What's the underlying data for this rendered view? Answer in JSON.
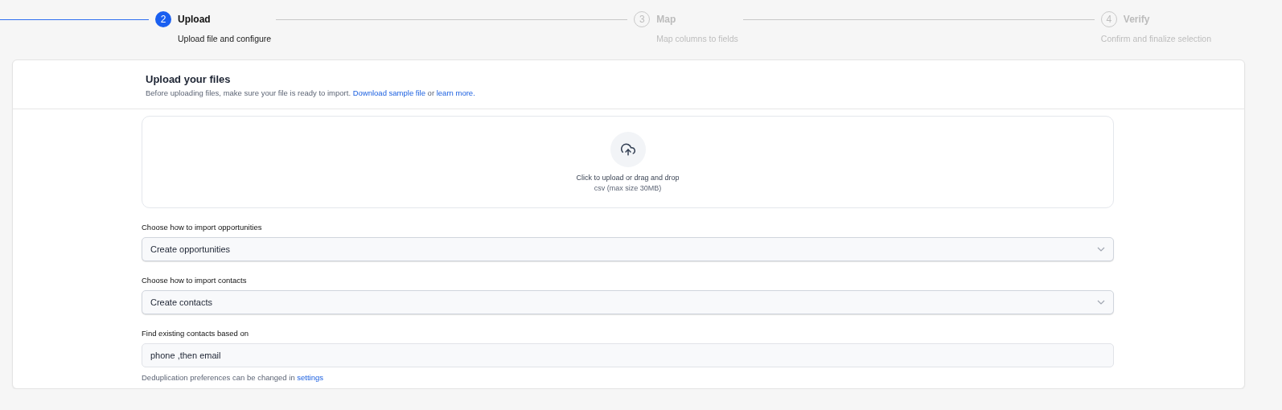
{
  "stepper": [
    {
      "number": "2",
      "title": "Upload",
      "subtitle": "Upload file and configure",
      "active": true
    },
    {
      "number": "3",
      "title": "Map",
      "subtitle": "Map columns to fields",
      "active": false
    },
    {
      "number": "4",
      "title": "Verify",
      "subtitle": "Confirm and finalize selection",
      "active": false
    }
  ],
  "card": {
    "title": "Upload your files",
    "description": "Before uploading files, make sure your file is ready to import.",
    "link_1": "Download sample file",
    "joiner": "or",
    "link_2": "learn more.",
    "dropzone": {
      "prompt": "Click to upload or drag and drop",
      "hint": "csv (max size 30MB)"
    },
    "fields": [
      {
        "kind": "select",
        "label": "Choose how to import opportunities",
        "value": "Create opportunities"
      },
      {
        "kind": "select",
        "label": "Choose how to import contacts",
        "value": "Create contacts"
      },
      {
        "kind": "text",
        "label": "Find existing contacts based on",
        "value": "phone ,then email"
      }
    ],
    "note": "Deduplication preferences can be changed in",
    "note_link": "settings"
  }
}
